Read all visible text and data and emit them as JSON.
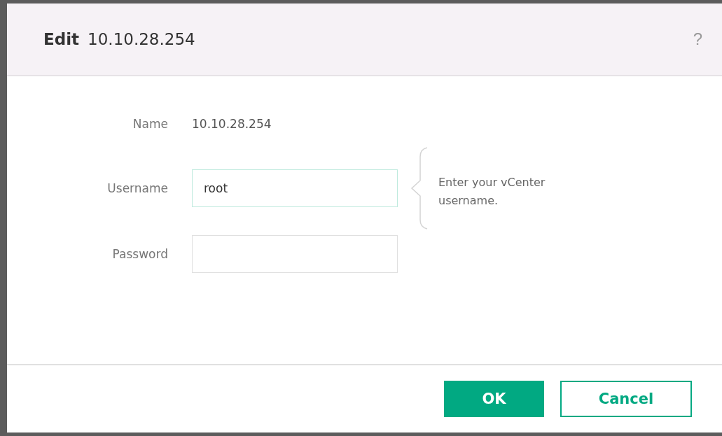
{
  "dialog": {
    "title_prefix": "Edit",
    "title": "10.10.28.254",
    "help": "?"
  },
  "name_row": {
    "label": "Name",
    "value": "10.10.28.254"
  },
  "fields": [
    {
      "label": "Username",
      "value": "root",
      "focused": true,
      "hint": "Enter your vCenter username."
    },
    {
      "label": "Password",
      "focused": false
    }
  ],
  "buttons": [
    {
      "label": "OK",
      "kind": "primary"
    },
    {
      "label": "Cancel",
      "kind": "secondary"
    }
  ]
}
